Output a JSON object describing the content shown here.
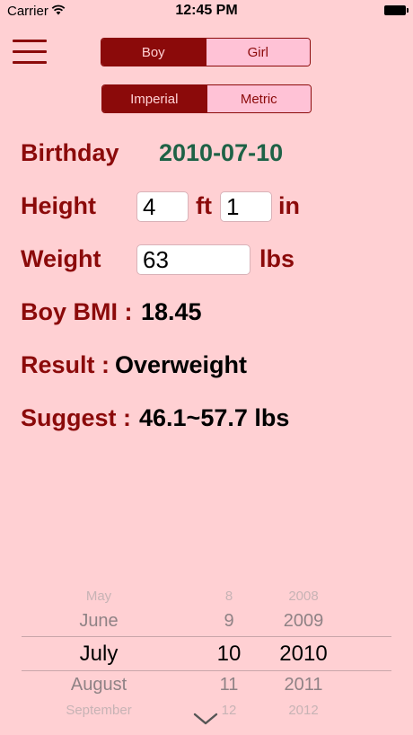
{
  "status_bar": {
    "carrier": "Carrier",
    "time": "12:45 PM"
  },
  "gender": {
    "options": [
      "Boy",
      "Girl"
    ],
    "selected": "Boy"
  },
  "units": {
    "options": [
      "Imperial",
      "Metric"
    ],
    "selected": "Imperial"
  },
  "birthday": {
    "label": "Birthday",
    "value": "2010-07-10"
  },
  "height": {
    "label": "Height",
    "feet": "4",
    "feet_unit": "ft",
    "inches": "1",
    "inches_unit": "in"
  },
  "weight": {
    "label": "Weight",
    "value": "63",
    "unit": "lbs"
  },
  "bmi": {
    "label": "Boy BMI :",
    "value": "18.45"
  },
  "result": {
    "label": "Result :",
    "value": "Overweight"
  },
  "suggest": {
    "label": "Suggest :",
    "value": "46.1~57.7 lbs"
  },
  "date_picker": {
    "months": [
      "May",
      "June",
      "July",
      "August",
      "September"
    ],
    "days": [
      "8",
      "9",
      "10",
      "11",
      "12"
    ],
    "years": [
      "2008",
      "2009",
      "2010",
      "2011",
      "2012"
    ],
    "selected_index": 2
  },
  "colors": {
    "background": "#ffd0d3",
    "accent": "#8b0a0a",
    "date": "#1e6246",
    "segment_off": "#ffc2d6"
  }
}
